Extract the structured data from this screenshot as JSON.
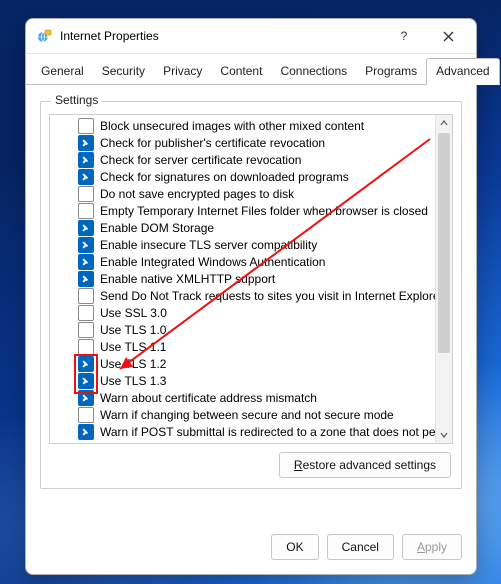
{
  "window": {
    "title": "Internet Properties",
    "help_tooltip": "?",
    "close_tooltip": "Close"
  },
  "tabs": {
    "items": [
      {
        "label": "General"
      },
      {
        "label": "Security"
      },
      {
        "label": "Privacy"
      },
      {
        "label": "Content"
      },
      {
        "label": "Connections"
      },
      {
        "label": "Programs"
      },
      {
        "label": "Advanced"
      }
    ],
    "active": 6
  },
  "settings": {
    "legend": "Settings",
    "items": [
      {
        "checked": false,
        "label": "Block unsecured images with other mixed content"
      },
      {
        "checked": true,
        "label": "Check for publisher's certificate revocation"
      },
      {
        "checked": true,
        "label": "Check for server certificate revocation"
      },
      {
        "checked": true,
        "label": "Check for signatures on downloaded programs"
      },
      {
        "checked": false,
        "label": "Do not save encrypted pages to disk"
      },
      {
        "checked": false,
        "label": "Empty Temporary Internet Files folder when browser is closed"
      },
      {
        "checked": true,
        "label": "Enable DOM Storage"
      },
      {
        "checked": true,
        "label": "Enable insecure TLS server compatibility"
      },
      {
        "checked": true,
        "label": "Enable Integrated Windows Authentication"
      },
      {
        "checked": true,
        "label": "Enable native XMLHTTP support"
      },
      {
        "checked": false,
        "label": "Send Do Not Track requests to sites you visit in Internet Explorer"
      },
      {
        "checked": false,
        "label": "Use SSL 3.0"
      },
      {
        "checked": false,
        "label": "Use TLS 1.0"
      },
      {
        "checked": false,
        "label": "Use TLS 1.1"
      },
      {
        "checked": true,
        "label": "Use TLS 1.2"
      },
      {
        "checked": true,
        "label": "Use TLS 1.3"
      },
      {
        "checked": true,
        "label": "Warn about certificate address mismatch"
      },
      {
        "checked": false,
        "label": "Warn if changing between secure and not secure mode"
      },
      {
        "checked": true,
        "label": "Warn if POST submittal is redirected to a zone that does not permit posts"
      }
    ],
    "restore_label_pre": "R",
    "restore_label_rest": "estore advanced settings"
  },
  "buttons": {
    "ok": "OK",
    "cancel": "Cancel",
    "apply_pre": "A",
    "apply_rest": "pply"
  },
  "annotation": {
    "highlight_rows": [
      14,
      15
    ]
  }
}
